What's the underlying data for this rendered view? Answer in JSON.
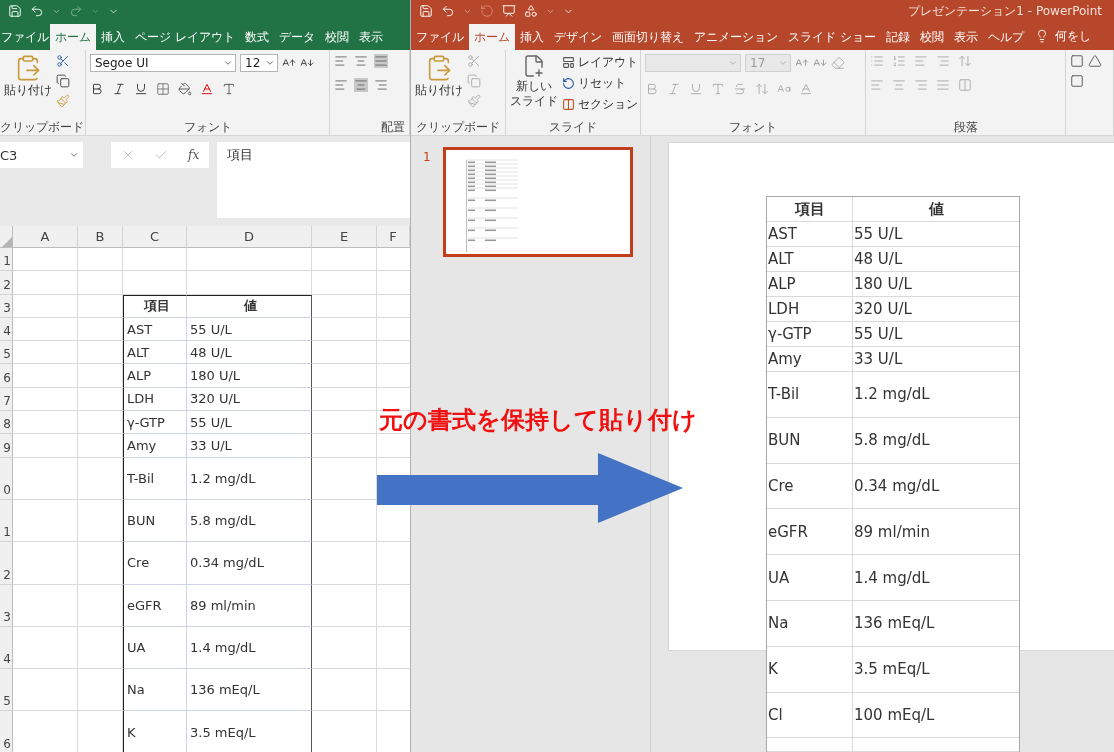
{
  "excel": {
    "tabs": [
      {
        "label": "ファイル",
        "selected": false
      },
      {
        "label": "ホーム",
        "selected": true
      },
      {
        "label": "挿入",
        "selected": false
      },
      {
        "label": "ページ レイアウト",
        "selected": false
      },
      {
        "label": "数式",
        "selected": false
      },
      {
        "label": "データ",
        "selected": false
      },
      {
        "label": "校閲",
        "selected": false
      },
      {
        "label": "表示",
        "selected": false
      }
    ],
    "ribbon": {
      "paste_label": "貼り付け",
      "font_name": "Segoe UI",
      "font_size": "12",
      "groups": [
        "クリップボード",
        "フォント",
        "配置"
      ]
    },
    "name_box": "C3",
    "formula_button": "fx",
    "formula": "項目",
    "columns": [
      "A",
      "B",
      "C",
      "D",
      "E",
      "F"
    ],
    "rows": [
      {
        "header": "1",
        "tall": false
      },
      {
        "header": "2",
        "tall": false
      },
      {
        "header": "3",
        "tall": false,
        "kind": "head",
        "item": "項目",
        "value": "値"
      },
      {
        "header": "4",
        "tall": false,
        "kind": "data",
        "item": "AST",
        "value": "55 U/L"
      },
      {
        "header": "5",
        "tall": false,
        "kind": "data",
        "item": "ALT",
        "value": "48 U/L"
      },
      {
        "header": "6",
        "tall": false,
        "kind": "data",
        "item": "ALP",
        "value": "180 U/L"
      },
      {
        "header": "7",
        "tall": false,
        "kind": "data",
        "item": "LDH",
        "value": "320 U/L"
      },
      {
        "header": "8",
        "tall": false,
        "kind": "data",
        "item": "γ-GTP",
        "value": "55 U/L"
      },
      {
        "header": "9",
        "tall": false,
        "kind": "data",
        "item": "Amy",
        "value": "33 U/L"
      },
      {
        "header": "0",
        "tall": true,
        "kind": "data",
        "item": "T-Bil",
        "value": "1.2 mg/dL"
      },
      {
        "header": "1",
        "tall": true,
        "kind": "data",
        "item": "BUN",
        "value": "5.8 mg/dL"
      },
      {
        "header": "2",
        "tall": true,
        "kind": "data",
        "item": "Cre",
        "value": "0.34 mg/dL"
      },
      {
        "header": "3",
        "tall": true,
        "kind": "data",
        "item": "eGFR",
        "value": "89 ml/min"
      },
      {
        "header": "4",
        "tall": true,
        "kind": "data",
        "item": "UA",
        "value": "1.4 mg/dL"
      },
      {
        "header": "5",
        "tall": true,
        "kind": "data",
        "item": "Na",
        "value": "136 mEq/L"
      },
      {
        "header": "6",
        "tall": true,
        "kind": "data",
        "item": "K",
        "value": "3.5 mEq/L"
      }
    ]
  },
  "powerpoint": {
    "title": "プレゼンテーション1  -  PowerPoint",
    "tabs": [
      {
        "label": "ファイル",
        "selected": false
      },
      {
        "label": "ホーム",
        "selected": true
      },
      {
        "label": "挿入",
        "selected": false
      },
      {
        "label": "デザイン",
        "selected": false
      },
      {
        "label": "画面切り替え",
        "selected": false
      },
      {
        "label": "アニメーション",
        "selected": false
      },
      {
        "label": "スライド ショー",
        "selected": false
      },
      {
        "label": "記録",
        "selected": false
      },
      {
        "label": "校閲",
        "selected": false
      },
      {
        "label": "表示",
        "selected": false
      },
      {
        "label": "ヘルプ",
        "selected": false
      }
    ],
    "tell_me": "何をし",
    "ribbon": {
      "paste_label": "貼り付け",
      "new_slide_label": [
        "新しい",
        "スライド"
      ],
      "layout_label": "レイアウト",
      "reset_label": "リセット",
      "section_label": "セクション",
      "font_size": "17",
      "groups": [
        "クリップボード",
        "スライド",
        "フォント",
        "段落"
      ]
    },
    "slides": [
      {
        "number": "1",
        "selected": true
      }
    ],
    "table": {
      "columns": [
        "項目",
        "値"
      ],
      "rows": [
        {
          "item": "AST",
          "value": "55 U/L",
          "tall": false
        },
        {
          "item": "ALT",
          "value": "48 U/L",
          "tall": false
        },
        {
          "item": "ALP",
          "value": "180 U/L",
          "tall": false
        },
        {
          "item": "LDH",
          "value": "320 U/L",
          "tall": false
        },
        {
          "item": "γ-GTP",
          "value": "55 U/L",
          "tall": false
        },
        {
          "item": "Amy",
          "value": "33 U/L",
          "tall": false
        },
        {
          "item": "T-Bil",
          "value": "1.2 mg/dL",
          "tall": true
        },
        {
          "item": "BUN",
          "value": "5.8 mg/dL",
          "tall": true
        },
        {
          "item": "Cre",
          "value": "0.34 mg/dL",
          "tall": true
        },
        {
          "item": "eGFR",
          "value": "89 ml/min",
          "tall": true
        },
        {
          "item": "UA",
          "value": "1.4 mg/dL",
          "tall": true
        },
        {
          "item": "Na",
          "value": "136 mEq/L",
          "tall": true
        },
        {
          "item": "K",
          "value": "3.5 mEq/L",
          "tall": true
        },
        {
          "item": "Cl",
          "value": "100 mEq/L",
          "tall": true
        }
      ]
    }
  },
  "annotation": {
    "caption": "元の書式を保持して貼り付け"
  }
}
